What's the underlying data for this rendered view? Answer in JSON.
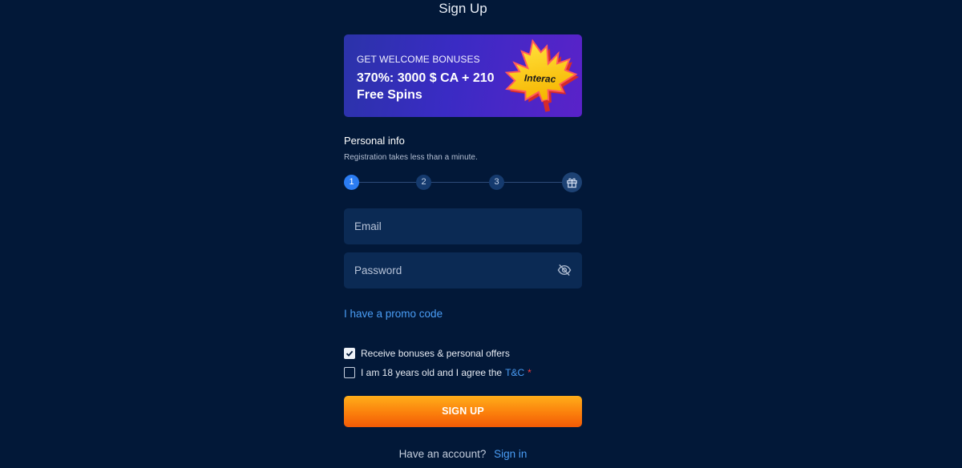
{
  "page": {
    "title": "Sign Up"
  },
  "banner": {
    "eyebrow": "GET WELCOME BONUSES",
    "headline": "370%: 3000 $ CA + 210 Free Spins",
    "badge_text": "Interac"
  },
  "personal_info": {
    "title": "Personal info",
    "subtitle": "Registration takes less than a minute."
  },
  "stepper": {
    "steps": [
      "1",
      "2",
      "3"
    ],
    "active_step": "1",
    "final_icon": "gift-icon"
  },
  "fields": {
    "email_placeholder": "Email",
    "password_placeholder": "Password"
  },
  "promo": {
    "label": "I have a promo code"
  },
  "checkboxes": {
    "bonuses_label": "Receive bonuses & personal offers",
    "bonuses_checked": true,
    "age_label": "I am 18 years old and I agree the",
    "age_link": "T&C",
    "age_required_mark": "*",
    "age_checked": false
  },
  "actions": {
    "signup_label": "SIGN UP"
  },
  "footer": {
    "prompt": "Have an account?",
    "signin_label": "Sign in"
  },
  "colors": {
    "background": "#021838",
    "field": "#0b2a54",
    "accent_link": "#4a9df5",
    "button_orange": "#fb7f0c",
    "step_active": "#2b7cf2"
  }
}
